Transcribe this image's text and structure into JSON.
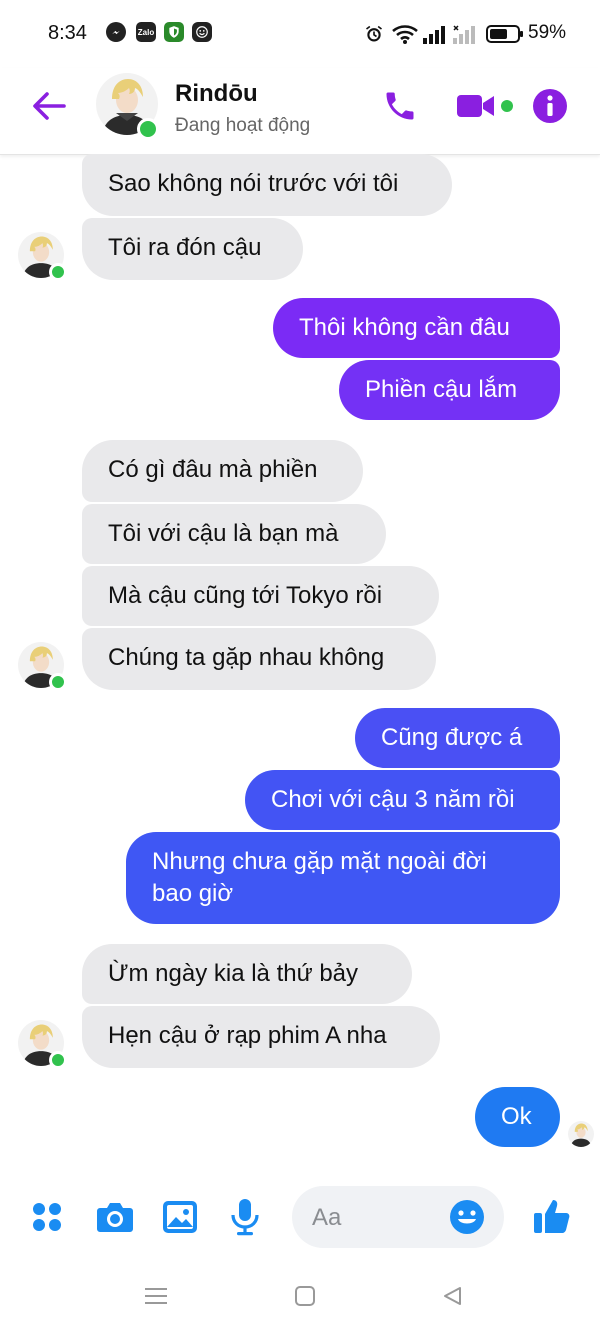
{
  "status_bar": {
    "time": "8:34",
    "battery": "59%",
    "app_icons": [
      "messenger-icon",
      "zalo-icon",
      "shield-icon",
      "face-icon"
    ],
    "zalo_text": "Zalo"
  },
  "header": {
    "contact_name": "Rindōu",
    "contact_status": "Đang hoạt động"
  },
  "messages": [
    {
      "side": "in",
      "text": "Sao không nói trước với tôi"
    },
    {
      "side": "in",
      "text": "Tôi ra đón cậu"
    },
    {
      "side": "out",
      "text": "Thôi không cần đâu"
    },
    {
      "side": "out",
      "text": "Phiền cậu lắm"
    },
    {
      "side": "in",
      "text": "Có gì đâu mà phiền"
    },
    {
      "side": "in",
      "text": "Tôi với cậu là bạn mà"
    },
    {
      "side": "in",
      "text": "Mà cậu cũng tới Tokyo rồi"
    },
    {
      "side": "in",
      "text": "Chúng ta gặp nhau không"
    },
    {
      "side": "out",
      "text": "Cũng được á"
    },
    {
      "side": "out",
      "text": "Chơi với cậu 3 năm rồi"
    },
    {
      "side": "out",
      "text": "Nhưng chưa gặp mặt ngoài đời bao giờ"
    },
    {
      "side": "in",
      "text": "Ừm ngày kia là thứ bảy"
    },
    {
      "side": "in",
      "text": "Hẹn cậu ở rạp phim A nha"
    },
    {
      "side": "out",
      "text": "Ok"
    }
  ],
  "composer": {
    "placeholder": "Aa"
  },
  "colors": {
    "accent_purple": "#8a1fe0",
    "bubble_purple": "#7b2bf5",
    "bubble_blue": "#3f57f4",
    "incoming_bg": "#e9e9eb",
    "online_green": "#31c24d",
    "composer_blue": "#1a8cf2"
  }
}
